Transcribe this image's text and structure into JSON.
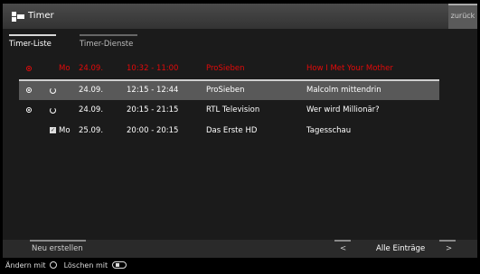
{
  "header": {
    "title": "Timer",
    "back_label": "zurück"
  },
  "tabs": [
    {
      "label": "Timer-Liste",
      "active": true
    },
    {
      "label": "Timer-Dienste",
      "active": false
    }
  ],
  "timers": [
    {
      "status_icon": "recording-icon",
      "repeat_icon": "",
      "day": "Mo",
      "date": "24.09.",
      "time": "10:32 - 11:00",
      "channel": "ProSieben",
      "title": "How I Met Your Mother",
      "recording": true,
      "selected": false
    },
    {
      "status_icon": "record-icon",
      "repeat_icon": "repeat-icon",
      "day": "",
      "date": "24.09.",
      "time": "12:15 - 12:44",
      "channel": "ProSieben",
      "title": "Malcolm mittendrin",
      "recording": false,
      "selected": true
    },
    {
      "status_icon": "record-icon",
      "repeat_icon": "repeat-icon",
      "day": "",
      "date": "24.09.",
      "time": "20:15 - 21:15",
      "channel": "RTL Television",
      "title": "Wer wird Millionär?",
      "recording": false,
      "selected": false
    },
    {
      "status_icon": "",
      "repeat_icon": "checkbox-icon",
      "day": "Mo",
      "date": "25.09.",
      "time": "20:00 - 20:15",
      "channel": "Das Erste HD",
      "title": "Tagesschau",
      "recording": false,
      "selected": false
    }
  ],
  "footer": {
    "new_label": "Neu erstellen",
    "prev_label": "<",
    "filter_label": "Alle Einträge",
    "next_label": ">"
  },
  "hint": {
    "edit_label": "Ändern mit",
    "delete_label": "Löschen mit"
  },
  "colors": {
    "recording": "#e30a0a",
    "selected_bg": "#595959",
    "panel_bg": "#1b1b1b"
  }
}
